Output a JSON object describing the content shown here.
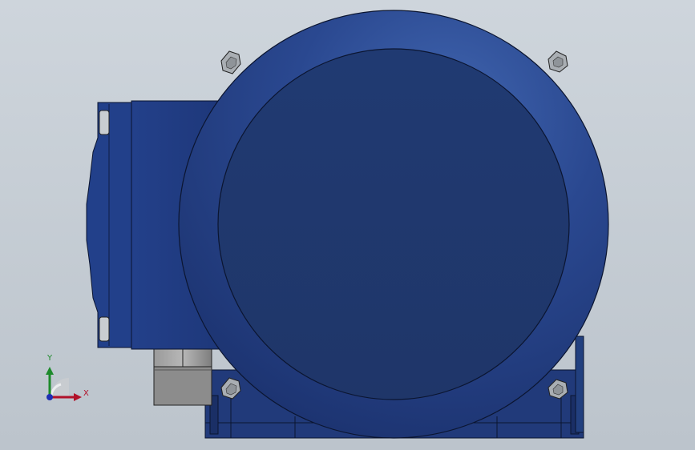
{
  "viewport": {
    "background_top": "#ced5dc",
    "background_bottom": "#bcc4cc"
  },
  "model": {
    "body_color": "#223b78",
    "edge_color": "#0b1530",
    "fitting_color": "#8c8c8c",
    "bolt_color": "#a9aeb3"
  },
  "triad": {
    "x_label": "X",
    "y_label": "Y",
    "x_color": "#b1122a",
    "y_color": "#1d8a2b",
    "z_color": "#1d2fb3"
  }
}
